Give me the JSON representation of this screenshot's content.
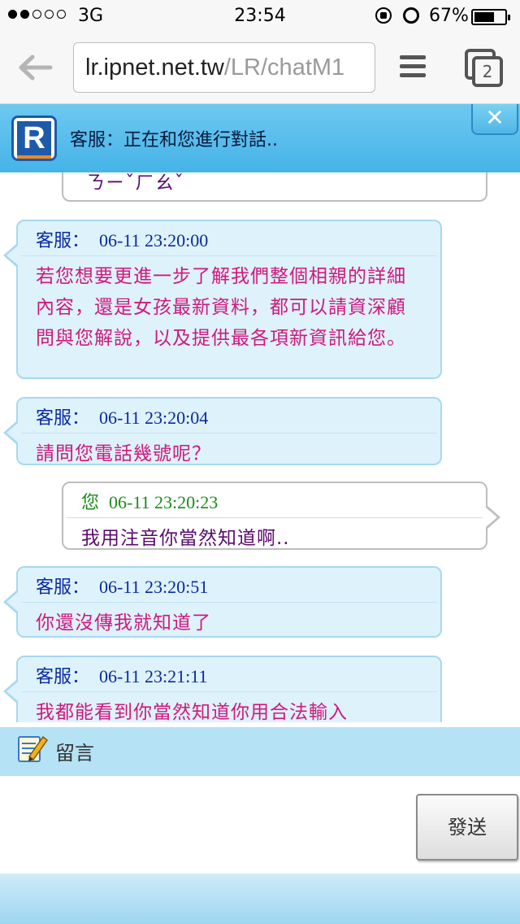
{
  "status_bar": {
    "carrier": "3G",
    "time": "23:54",
    "battery": "67%",
    "battery_level": 0.67,
    "signal_bars": 2
  },
  "browser": {
    "url_host": "lr.ipnet.net.tw",
    "url_path": "/LR/chatM1",
    "tab_count": "2"
  },
  "chat_header": {
    "logo_letter": "R",
    "title": "客服：正在和您進行對話.."
  },
  "partial_message": "ㄋㄧˇㄏㄠˇ",
  "messages": [
    {
      "sender": "客服：",
      "time": "06-11 23:20:00",
      "text": "若您想要更進一步了解我們整個相親的詳細內容，還是女孩最新資料，都可以請資深顧問與您解說，以及提供最各項新資訊給您。"
    },
    {
      "sender": "客服：",
      "time": "06-11 23:20:04",
      "text": "請問您電話幾號呢？"
    },
    {
      "sender": "您",
      "time": "06-11 23:20:23",
      "text": "我用注音你當然知道啊.."
    },
    {
      "sender": "客服：",
      "time": "06-11 23:20:51",
      "text": "你還沒傳我就知道了"
    },
    {
      "sender": "客服：",
      "time": "06-11 23:21:11",
      "text": "我都能看到你當然知道你用合法輸入"
    }
  ],
  "leave_message_label": "留言",
  "send_button_label": "發送",
  "colors": {
    "header_blue": "#45b4e8",
    "agent_text": "#d0187e",
    "agent_name": "#0a2aa0",
    "user_name": "#1a8a1a",
    "user_text": "#5a0a6e"
  }
}
